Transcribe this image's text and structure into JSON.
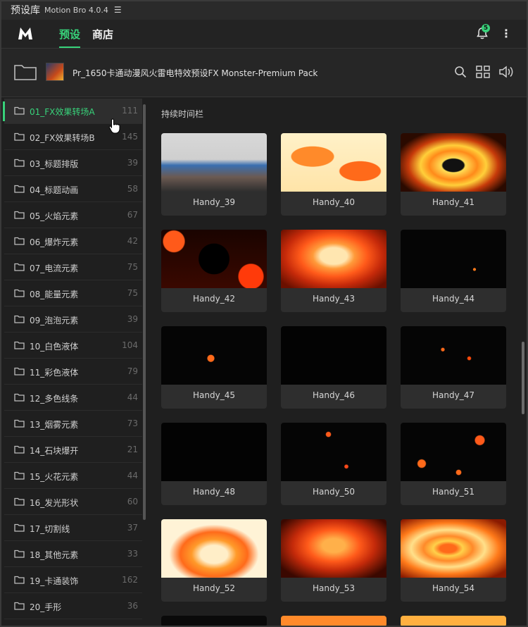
{
  "titlebar": {
    "title": "预设库",
    "version": "Motion Bro 4.0.4"
  },
  "header": {
    "tabs": [
      {
        "label": "预设",
        "active": true
      },
      {
        "label": "商店",
        "active": false
      }
    ],
    "notification_count": "5",
    "accent_color": "#38d27a"
  },
  "pack": {
    "title": "Pr_1650卡通动漫风火雷电特效预设FX Monster-Premium Pack"
  },
  "sidebar": {
    "items": [
      {
        "label": "01_FX效果转场A",
        "count": "111"
      },
      {
        "label": "02_FX效果转场B",
        "count": "145"
      },
      {
        "label": "03_标题排版",
        "count": "39"
      },
      {
        "label": "04_标题动画",
        "count": "58"
      },
      {
        "label": "05_火焰元素",
        "count": "67"
      },
      {
        "label": "06_爆炸元素",
        "count": "42"
      },
      {
        "label": "07_电流元素",
        "count": "75"
      },
      {
        "label": "08_能量元素",
        "count": "75"
      },
      {
        "label": "09_泡泡元素",
        "count": "39"
      },
      {
        "label": "10_白色液体",
        "count": "104"
      },
      {
        "label": "11_彩色液体",
        "count": "79"
      },
      {
        "label": "12_多色线条",
        "count": "44"
      },
      {
        "label": "13_烟雾元素",
        "count": "73"
      },
      {
        "label": "14_石块爆开",
        "count": "21"
      },
      {
        "label": "15_火花元素",
        "count": "44"
      },
      {
        "label": "16_发光形状",
        "count": "60"
      },
      {
        "label": "17_切割线",
        "count": "37"
      },
      {
        "label": "18_其他元素",
        "count": "33"
      },
      {
        "label": "19_卡通装饰",
        "count": "162"
      },
      {
        "label": "20_手形",
        "count": "36"
      }
    ]
  },
  "content": {
    "section_title": "持续时间栏",
    "cards": [
      {
        "label": "Handy_39"
      },
      {
        "label": "Handy_40"
      },
      {
        "label": "Handy_41"
      },
      {
        "label": "Handy_42"
      },
      {
        "label": "Handy_43"
      },
      {
        "label": "Handy_44"
      },
      {
        "label": "Handy_45"
      },
      {
        "label": "Handy_46"
      },
      {
        "label": "Handy_47"
      },
      {
        "label": "Handy_48"
      },
      {
        "label": "Handy_50"
      },
      {
        "label": "Handy_51"
      },
      {
        "label": "Handy_52"
      },
      {
        "label": "Handy_53"
      },
      {
        "label": "Handy_54"
      }
    ]
  }
}
